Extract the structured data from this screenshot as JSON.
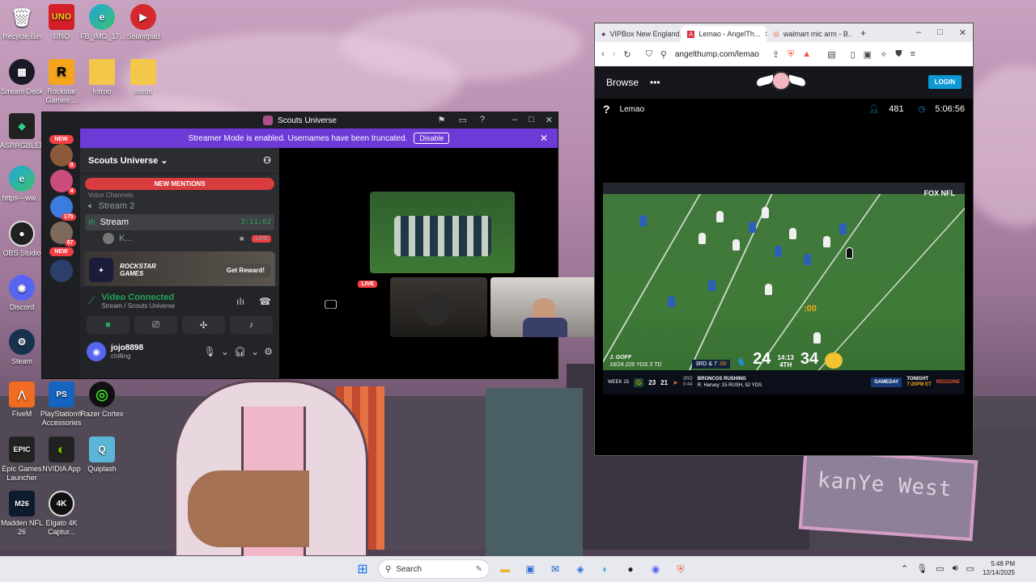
{
  "desktop": {
    "icons": [
      {
        "label": "Recycle Bin",
        "glyph": "🗑"
      },
      {
        "label": "UNO",
        "glyph": "UNO"
      },
      {
        "label": "FB_IMG_17...",
        "glyph": "e"
      },
      {
        "label": "Soundpad",
        "glyph": "▶"
      },
      {
        "label": "Stream Deck",
        "glyph": "▦"
      },
      {
        "label": "Rockstar Games ...",
        "glyph": "R"
      },
      {
        "label": "Introo",
        "glyph": ""
      },
      {
        "label": "intros",
        "glyph": ""
      },
      {
        "label": "ASRRGBLED",
        "glyph": "◆"
      },
      {
        "label": "https---ww...",
        "glyph": "e"
      },
      {
        "label": "OBS Studio",
        "glyph": "●"
      },
      {
        "label": "Discord",
        "glyph": "◉"
      },
      {
        "label": "Steam",
        "glyph": "⚙"
      },
      {
        "label": "FiveM",
        "glyph": "⋀"
      },
      {
        "label": "PlayStation® Accessories",
        "glyph": "PS"
      },
      {
        "label": "Razer Cortex",
        "glyph": "◎"
      },
      {
        "label": "Epic Games Launcher",
        "glyph": "EPIC"
      },
      {
        "label": "NVIDIA App",
        "glyph": "◐"
      },
      {
        "label": "Quiplash",
        "glyph": "Q"
      },
      {
        "label": "Madden NFL 26",
        "glyph": "M26"
      },
      {
        "label": "Elgato 4K Captur...",
        "glyph": "4K"
      }
    ],
    "wallpaper_sign": "kanYe West"
  },
  "discord": {
    "window_title": "Scouts Universe",
    "banner_text": "Streamer Mode is enabled. Usernames have been truncated.",
    "banner_button": "Disable",
    "server_rail": {
      "new_top": "NEW",
      "badges": [
        "8",
        "4",
        "175",
        "67"
      ],
      "new_bottom": "NEW"
    },
    "server_name": "Scouts Universe",
    "new_mentions": "NEW MENTIONS",
    "category": "Voice Channels",
    "channels": [
      {
        "name": "Stream 2"
      },
      {
        "name": "Stream",
        "timer": "3:11:02"
      }
    ],
    "member": {
      "name": "K...",
      "badge": "LIVE"
    },
    "promo": {
      "brand_line1": "ROCKSTAR",
      "brand_line2": "GAMES",
      "button": "Get Reward!"
    },
    "voice": {
      "status": "Video Connected",
      "location": "Stream / Scouts Universe"
    },
    "user": {
      "name": "jojo8898",
      "status": "chilling"
    },
    "grid_live_badge": "LIVE"
  },
  "browser": {
    "tabs": [
      {
        "title": "VIPBox New England..."
      },
      {
        "title": "Lemao - AngelTh..."
      },
      {
        "title": "walmart mic arm - B..."
      }
    ],
    "url": "angelthump.com/lemao",
    "site": {
      "browse": "Browse",
      "more": "•••",
      "login": "LOGIN",
      "streamer": "Lemao",
      "viewers": "481",
      "uptime": "5:06:56"
    },
    "game": {
      "network": "FOX NFL",
      "passer": "J. GOFF",
      "passer_stats": "16/24 226 YDS 3 TD",
      "down": "3RD & 7",
      "playclock": ":00",
      "home_score": "24",
      "quarter_clock": "14:13",
      "quarter": "4TH",
      "away_score": "34",
      "overlay_clock": ":00",
      "ticker_week": "WEEK 15",
      "ticker_score1": "23",
      "ticker_score2": "21",
      "ticker_down": "3RD",
      "ticker_time": "0:44",
      "ticker_head": "BRONCOS RUSHING",
      "ticker_line": "R. Harvey: 15 RUSH, 52 YDS",
      "gameday": "GAMEDAY",
      "tonight": "TONIGHT",
      "tonight_time": "7:20PM ET",
      "redzone": "REDZONE"
    }
  },
  "taskbar": {
    "search": "Search",
    "time": "5:48 PM",
    "date": "12/14/2025"
  },
  "colors": {
    "discord_accent": "#6d3ad7",
    "live_red": "#f23f43",
    "voice_green": "#23a55a",
    "login_blue": "#0d99d6"
  }
}
